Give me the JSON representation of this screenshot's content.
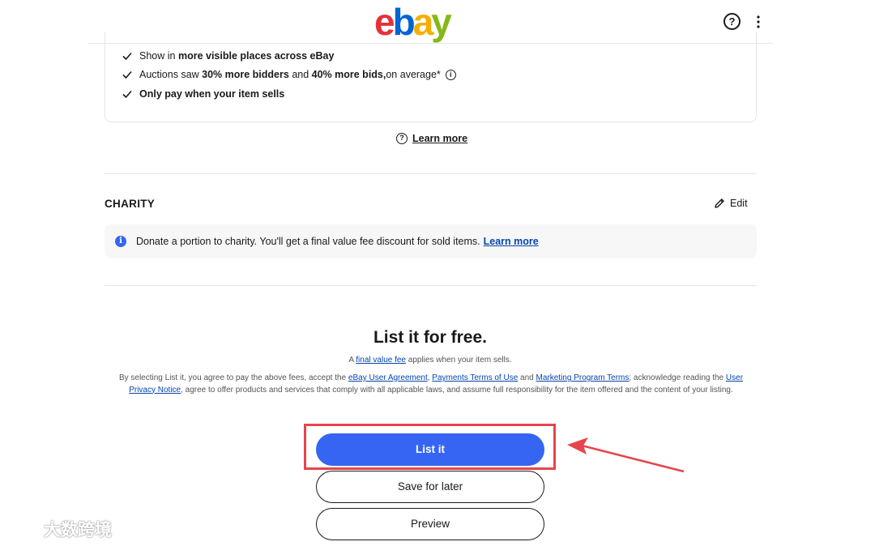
{
  "header": {
    "logo_letters": [
      {
        "char": "e",
        "color": "#e53238"
      },
      {
        "char": "b",
        "color": "#0064d2"
      },
      {
        "char": "a",
        "color": "#f5af02"
      },
      {
        "char": "y",
        "color": "#86b817"
      }
    ],
    "help_icon": "question-circle-icon",
    "help_glyph": "?",
    "more_icon": "vertical-dots-icon",
    "more_glyph": "⋮"
  },
  "benefits": {
    "items": [
      {
        "pre": "Show in ",
        "bold": "more visible places across eBay",
        "mid": "",
        "bold2": "",
        "post": ""
      },
      {
        "pre": "Auctions saw ",
        "bold": "30% more bidders",
        "mid": " and ",
        "bold2": "40% more bids,",
        "post": " on average*"
      },
      {
        "pre": "",
        "bold": "Only pay when your item sells",
        "mid": "",
        "bold2": "",
        "post": ""
      }
    ],
    "info_glyph": "i",
    "learn_more_glyph": "?",
    "learn_more": "Learn more"
  },
  "charity": {
    "title": "CHARITY",
    "edit_label": "Edit",
    "info_glyph": "i",
    "message": "Donate a portion to charity. You'll get a final value fee discount for sold items.",
    "learn_more": "Learn more"
  },
  "submit": {
    "title": "List it for free.",
    "fee_pre": "A ",
    "fee_link": "final value fee",
    "fee_post": " applies when your item sells.",
    "legal": {
      "t1": "By selecting List it, you agree to pay the above fees, accept the ",
      "l1": "eBay User Agreement",
      "t2": ", ",
      "l2": "Payments Terms of Use",
      "t3": " and ",
      "l3": "Marketing Program Terms",
      "t4": "; acknowledge reading the ",
      "l4": "User Privacy Notice",
      "t5": ", agree to offer products and services that comply with all applicable laws, and assume full responsibility for the item offered and the content of your listing."
    },
    "list_it": "List it",
    "save_for_later": "Save for later",
    "preview": "Preview"
  },
  "annotation": {
    "highlight_color": "#e5454c"
  },
  "watermark": {
    "text": "大数跨境"
  },
  "colors": {
    "primary": "#3665f3",
    "link": "#0645ad",
    "border": "#e5e5e5"
  }
}
